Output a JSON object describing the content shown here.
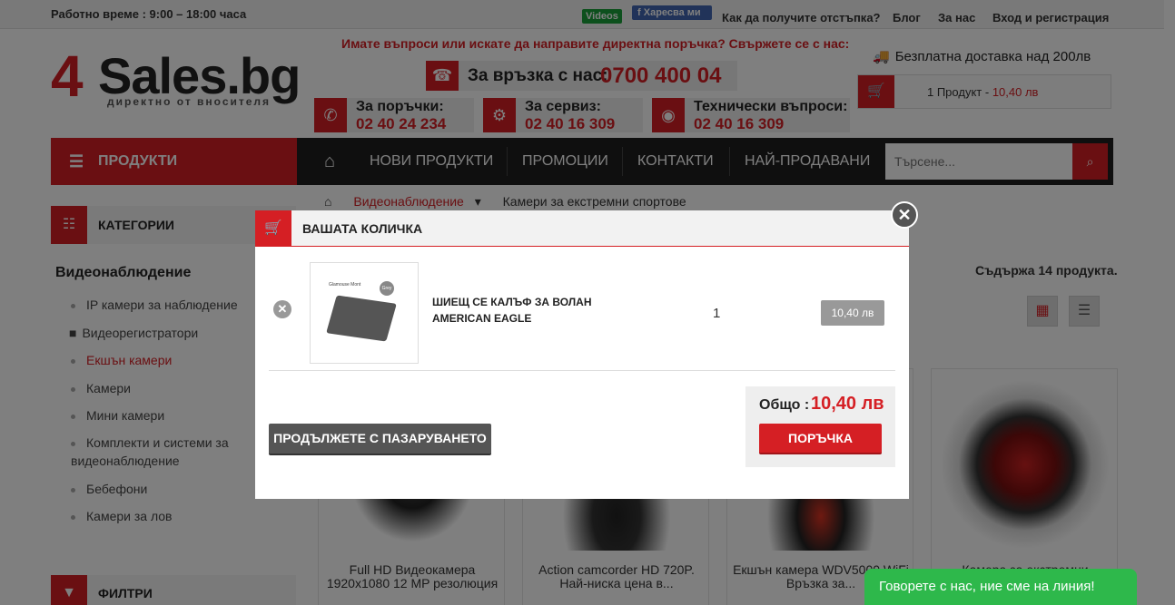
{
  "topbar": {
    "hours": "Работно време : 9:00 – 18:00 часа",
    "videos": "Videos",
    "fb_like": "Харесва ми",
    "links": [
      "Как да получите отстъпка?",
      "Блог",
      "За нас",
      "Вход и регистрация"
    ]
  },
  "logo": {
    "four": "4",
    "name": "Sales.bg",
    "tagline": "директно от вносителя"
  },
  "header": {
    "question": "Имате въпроси или искате да направите директна поръчка? Свържете се с нас:",
    "contact_label": "За връзка с нас:",
    "contact_number": "0700 400 04",
    "phones": [
      {
        "label": "За поръчки:",
        "number": "02 40 24 234",
        "icon": "phone-icon"
      },
      {
        "label": "За сервиз:",
        "number": "02 40 16 309",
        "icon": "gears-icon"
      },
      {
        "label": "Технически въпроси:",
        "number": "02 40 16 309",
        "icon": "support-icon"
      }
    ],
    "delivery": "Безплатна доставка над 200лв",
    "minicart_count": "1 Продукт -",
    "minicart_price": "10,40 лв"
  },
  "nav": {
    "products": "ПРОДУКТИ",
    "items": [
      "НОВИ ПРОДУКТИ",
      "ПРОМОЦИИ",
      "КОНТАКТИ",
      "НАЙ-ПРОДАВАНИ"
    ],
    "search_placeholder": "Търсене..."
  },
  "sidebar": {
    "categories_title": "КАТЕГОРИИ",
    "heading": "Видеонаблюдение",
    "items": [
      {
        "label": "IP камери за наблюдение"
      },
      {
        "label": "Видеорегистратори"
      },
      {
        "label": "Екшън камери"
      },
      {
        "label": "Камери"
      },
      {
        "label": "Мини камери"
      },
      {
        "label": "Комплекти и системи за"
      },
      {
        "label": "видеонаблюдение"
      },
      {
        "label": "Бебефони"
      },
      {
        "label": "Камери за лов"
      }
    ],
    "filters_title": "ФИЛТРИ"
  },
  "breadcrumb": {
    "level1": "Видеонаблюдение",
    "level2": "Камери за екстремни спортове"
  },
  "listing": {
    "count": "Съдържа 14 продукта.",
    "products": [
      {
        "title": "Full HD Видеокамера 1920x1080 12 MP резолюция"
      },
      {
        "title": "Action camcorder HD 720P. Най-ниска цена в..."
      },
      {
        "title": "Екшън камера WDV5000 WiFi Връзка за..."
      },
      {
        "title": "Камера за екстремни"
      }
    ]
  },
  "cart_modal": {
    "title": "ВАШАТА КОЛИЧКА",
    "item_name": "ШИЕЩ СЕ КАЛЪФ ЗА ВОЛАН AMERICAN EAGLE",
    "thumb_text": "Glamouse Mont",
    "thumb_badge": "Grey",
    "quantity": "1",
    "item_price": "10,40 лв",
    "continue": "ПРОДЪЛЖЕТЕ С ПАЗАРУВАНЕТО",
    "total_label": "Общо :",
    "total_value": "10,40 лв",
    "order": "ПОРЪЧКА"
  },
  "chat": "Говорете с нас, ние сме на линия!",
  "colors": {
    "accent": "#d51f24",
    "dark": "#1f1f1f",
    "chat": "#2eb84b"
  }
}
